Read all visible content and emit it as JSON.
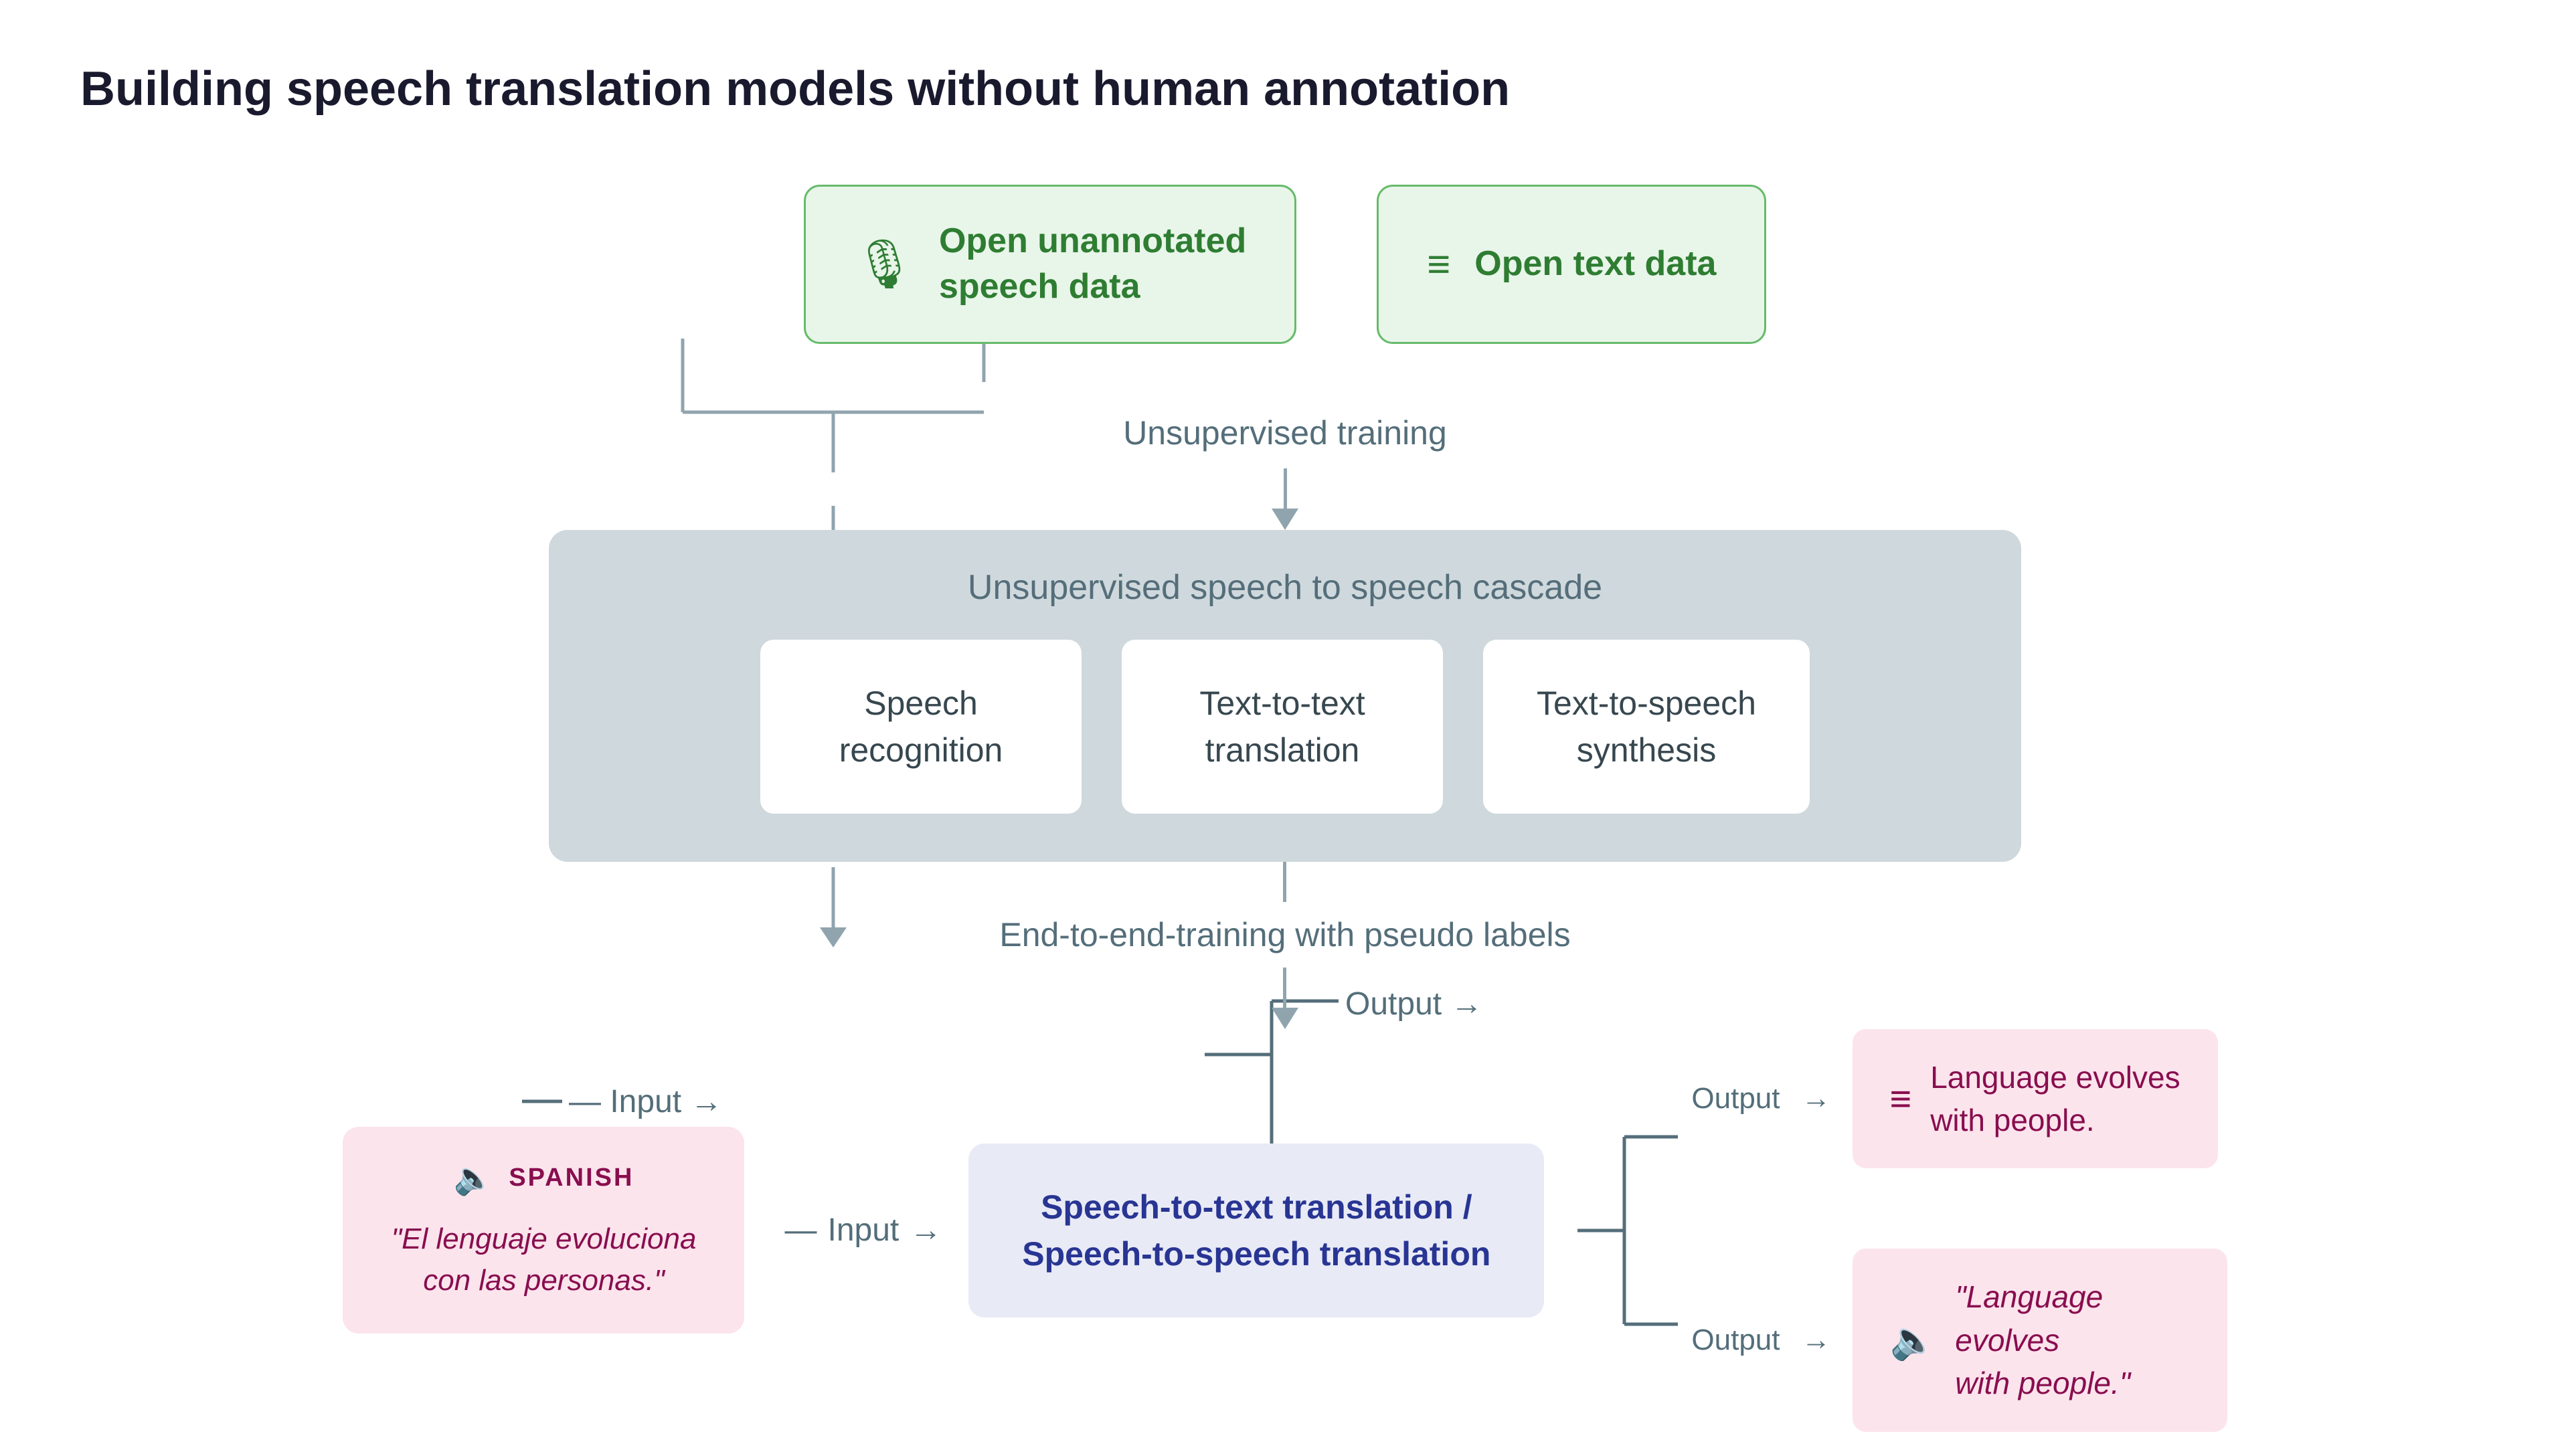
{
  "page": {
    "title": "Building speech translation models without human annotation"
  },
  "top_boxes": [
    {
      "id": "speech-data-box",
      "icon": "🎙",
      "text": "Open unannotated\nspeech data",
      "bg_color": "#e8f5e9",
      "border_color": "#66bb6a",
      "text_color": "#2e7d32"
    },
    {
      "id": "text-data-box",
      "icon": "≡",
      "text": "Open text data",
      "bg_color": "#e8f5e9",
      "border_color": "#66bb6a",
      "text_color": "#2e7d32"
    }
  ],
  "steps": [
    {
      "id": "unsupervised-training",
      "label": "Unsupervised training"
    },
    {
      "id": "end-to-end-training",
      "label": "End-to-end-training with pseudo labels"
    }
  ],
  "cascade": {
    "title": "Unsupervised speech to speech cascade",
    "boxes": [
      {
        "id": "speech-recognition",
        "text": "Speech\nrecognition"
      },
      {
        "id": "text-to-text",
        "text": "Text-to-text\ntranslation"
      },
      {
        "id": "text-to-speech",
        "text": "Text-to-speech\nsynthesis"
      }
    ]
  },
  "bottom": {
    "input": {
      "language_label": "SPANISH",
      "quote": "\"El lenguaje evoluciona\ncon las personas.\"",
      "bg_color": "#fce4ec"
    },
    "center_box": {
      "text": "Speech-to-text translation /\nSpeech-to-speech translation",
      "bg_color": "#e8eaf6",
      "text_color": "#283593"
    },
    "outputs": [
      {
        "id": "text-output",
        "type": "text",
        "text": "Language evolves\nwith people.",
        "bg_color": "#fce4ec"
      },
      {
        "id": "speech-output",
        "type": "speech",
        "quote": "\"Language evolves\nwith people.\"",
        "bg_color": "#fce4ec"
      }
    ],
    "connector_labels": {
      "input": "Input",
      "output": "Output"
    }
  },
  "colors": {
    "accent_green": "#2e7d32",
    "accent_pink": "#880e4f",
    "accent_blue": "#283593",
    "connector": "#90a4ae",
    "gray_bg": "#cfd8dc",
    "white": "#ffffff"
  }
}
